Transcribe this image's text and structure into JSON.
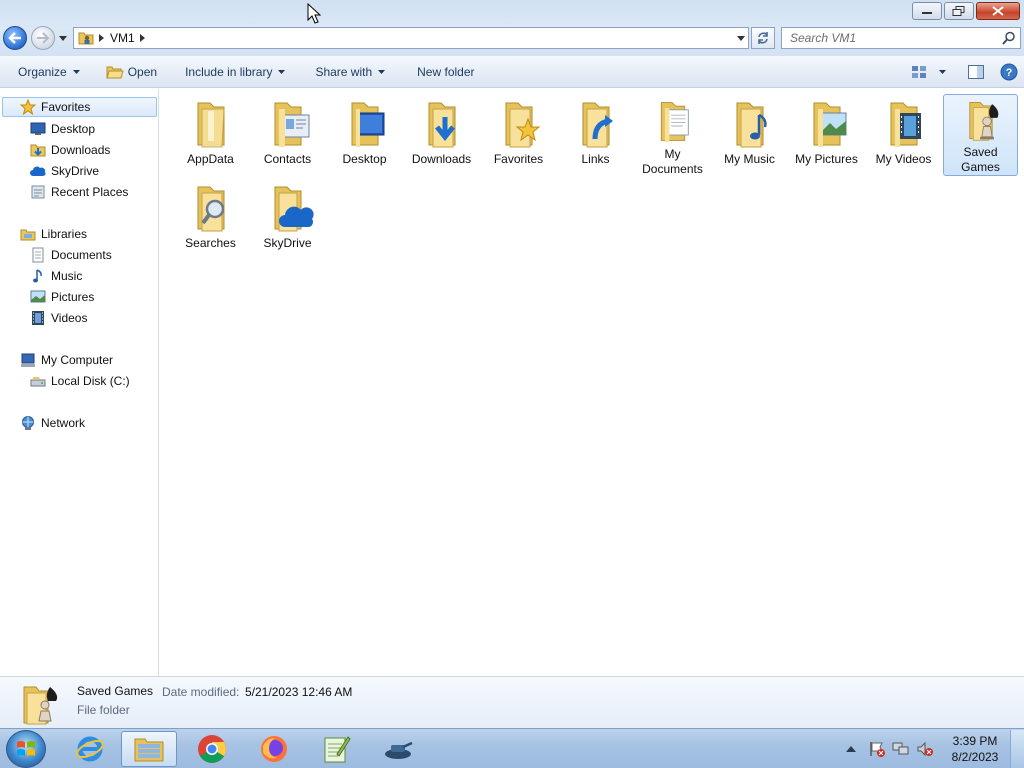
{
  "window": {
    "controls": {
      "minimize": "minimize",
      "maximize": "restore",
      "close": "close"
    }
  },
  "address": {
    "crumbs": [
      "VM1"
    ],
    "search_placeholder": "Search VM1"
  },
  "toolbar": {
    "organize": "Organize",
    "open": "Open",
    "include_in_library": "Include in library",
    "share_with": "Share with",
    "new_folder": "New folder"
  },
  "nav": {
    "favorites": {
      "label": "Favorites",
      "items": [
        {
          "label": "Desktop",
          "icon": "desktop-icon"
        },
        {
          "label": "Downloads",
          "icon": "downloads-icon"
        },
        {
          "label": "SkyDrive",
          "icon": "skydrive-icon"
        },
        {
          "label": "Recent Places",
          "icon": "recent-places-icon"
        }
      ]
    },
    "libraries": {
      "label": "Libraries",
      "items": [
        {
          "label": "Documents",
          "icon": "documents-icon"
        },
        {
          "label": "Music",
          "icon": "music-icon"
        },
        {
          "label": "Pictures",
          "icon": "pictures-icon"
        },
        {
          "label": "Videos",
          "icon": "videos-icon"
        }
      ]
    },
    "computer": {
      "label": "My Computer",
      "items": [
        {
          "label": "Local Disk (C:)",
          "icon": "local-disk-icon"
        }
      ]
    },
    "network": {
      "label": "Network"
    }
  },
  "folders": [
    {
      "label": "AppData",
      "icon": "appdata-folder-icon"
    },
    {
      "label": "Contacts",
      "icon": "contacts-folder-icon"
    },
    {
      "label": "Desktop",
      "icon": "desktop-folder-icon"
    },
    {
      "label": "Downloads",
      "icon": "downloads-folder-icon"
    },
    {
      "label": "Favorites",
      "icon": "favorites-folder-icon"
    },
    {
      "label": "Links",
      "icon": "links-folder-icon"
    },
    {
      "label": "My Documents",
      "icon": "documents-folder-icon"
    },
    {
      "label": "My Music",
      "icon": "music-folder-icon"
    },
    {
      "label": "My Pictures",
      "icon": "pictures-folder-icon"
    },
    {
      "label": "My Videos",
      "icon": "videos-folder-icon"
    },
    {
      "label": "Saved Games",
      "icon": "saved-games-folder-icon",
      "selected": true
    },
    {
      "label": "Searches",
      "icon": "searches-folder-icon"
    },
    {
      "label": "SkyDrive",
      "icon": "skydrive-folder-icon"
    }
  ],
  "details": {
    "name": "Saved Games",
    "modified_label": "Date modified:",
    "modified_value": "5/21/2023 12:46 AM",
    "type": "File folder"
  },
  "taskbar": {
    "apps": [
      "internet-explorer-icon",
      "file-explorer-icon",
      "chrome-icon",
      "firefox-icon",
      "notepad-plus-plus-icon",
      "tank-app-icon"
    ],
    "clock_time": "3:39 PM",
    "clock_date": "8/2/2023"
  },
  "colors": {
    "folder_yellow": "#f2d97a",
    "selection_blue": "#cfe4fa",
    "toolbar_text": "#1e395b"
  }
}
